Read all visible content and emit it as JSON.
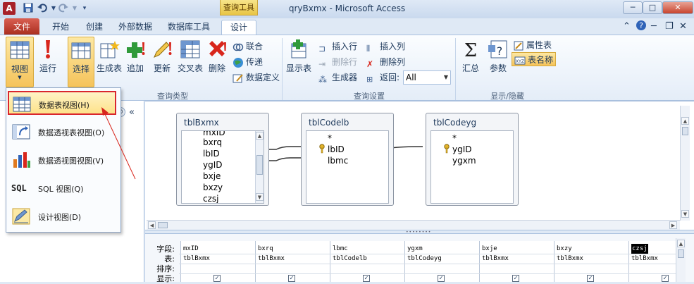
{
  "window": {
    "title": "qryBxmx  -  Microsoft Access",
    "context_tab_label": "查询工具",
    "app_icon_letter": "A",
    "minimize": "─",
    "maximize": "□",
    "close": "✕"
  },
  "tabs": {
    "file": "文件",
    "home": "开始",
    "create": "创建",
    "external": "外部数据",
    "dbtools": "数据库工具",
    "design": "设计"
  },
  "ribbon": {
    "results": {
      "view": "视图",
      "run": "运行"
    },
    "query_type": {
      "label": "查询类型",
      "select": "选择",
      "make_table": "生成表",
      "append": "追加",
      "update": "更新",
      "crosstab": "交叉表",
      "delete": "删除",
      "union": "联合",
      "passthrough": "传递",
      "data_definition": "数据定义"
    },
    "query_setup": {
      "label": "查询设置",
      "show_table": "显示表",
      "insert_rows": "插入行",
      "delete_rows": "删除行",
      "builder": "生成器",
      "insert_cols": "插入列",
      "delete_cols": "删除列",
      "return_label": "返回:",
      "return_value": "All"
    },
    "show_hide": {
      "label": "显示/隐藏",
      "totals": "汇总",
      "params": "参数",
      "property_sheet": "属性表",
      "table_names": "表名称"
    }
  },
  "view_menu": {
    "items": [
      {
        "label": "数据表视图(H)"
      },
      {
        "label": "数据透视表视图(O)"
      },
      {
        "label": "数据透视图视图(V)"
      },
      {
        "label": "SQL 视图(Q)",
        "prefix": "SQL"
      },
      {
        "label": "设计视图(D)"
      }
    ]
  },
  "nav": {
    "collapse": "«"
  },
  "diagram": {
    "tables": [
      {
        "name": "tblBxmx",
        "fields": [
          "mxID",
          "bxrq",
          "lbID",
          "ygID",
          "bxje",
          "bxzy",
          "czsj"
        ]
      },
      {
        "name": "tblCodelb",
        "fields": [
          "*",
          "lbID",
          "lbmc"
        ]
      },
      {
        "name": "tblCodeyg",
        "fields": [
          "*",
          "ygID",
          "ygxm"
        ]
      }
    ]
  },
  "grid": {
    "row_labels": [
      "字段:",
      "表:",
      "排序:",
      "显示:"
    ],
    "columns": [
      {
        "field": "mxID",
        "table": "tblBxmx"
      },
      {
        "field": "bxrq",
        "table": "tblBxmx"
      },
      {
        "field": "lbmc",
        "table": "tblCodelb"
      },
      {
        "field": "ygxm",
        "table": "tblCodeyg"
      },
      {
        "field": "bxje",
        "table": "tblBxmx"
      },
      {
        "field": "bxzy",
        "table": "tblBxmx"
      },
      {
        "field": "czsj",
        "table": "tblBxmx"
      }
    ],
    "check_mark": "✓"
  }
}
